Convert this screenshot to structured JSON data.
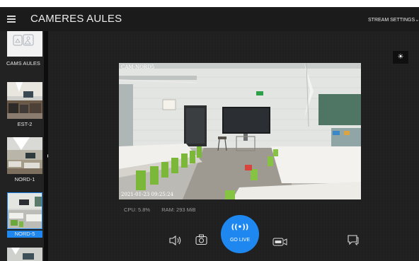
{
  "app": {
    "title": "CAMERES AULES",
    "stream_settings_label": "STREAM SETTINGS"
  },
  "sidebar": {
    "group_label": "CAMS AULES",
    "items": [
      {
        "label": "EST-2",
        "selected": false
      },
      {
        "label": "NORD-1",
        "selected": false
      },
      {
        "label": "NORD-5",
        "selected": true
      }
    ]
  },
  "preview": {
    "camera_name": "CAM-NORD5",
    "timestamp": "2021-01-23 09:25:24"
  },
  "stats": {
    "cpu": "CPU: 5.8%",
    "ram": "RAM: 293 MiB"
  },
  "controls": {
    "go_live_label": "GO LIVE",
    "go_live_icon": "((•))"
  },
  "colors": {
    "accent": "#1e88f0",
    "selected_label_bg": "#1e88f0",
    "background": "#1b1b1b"
  }
}
